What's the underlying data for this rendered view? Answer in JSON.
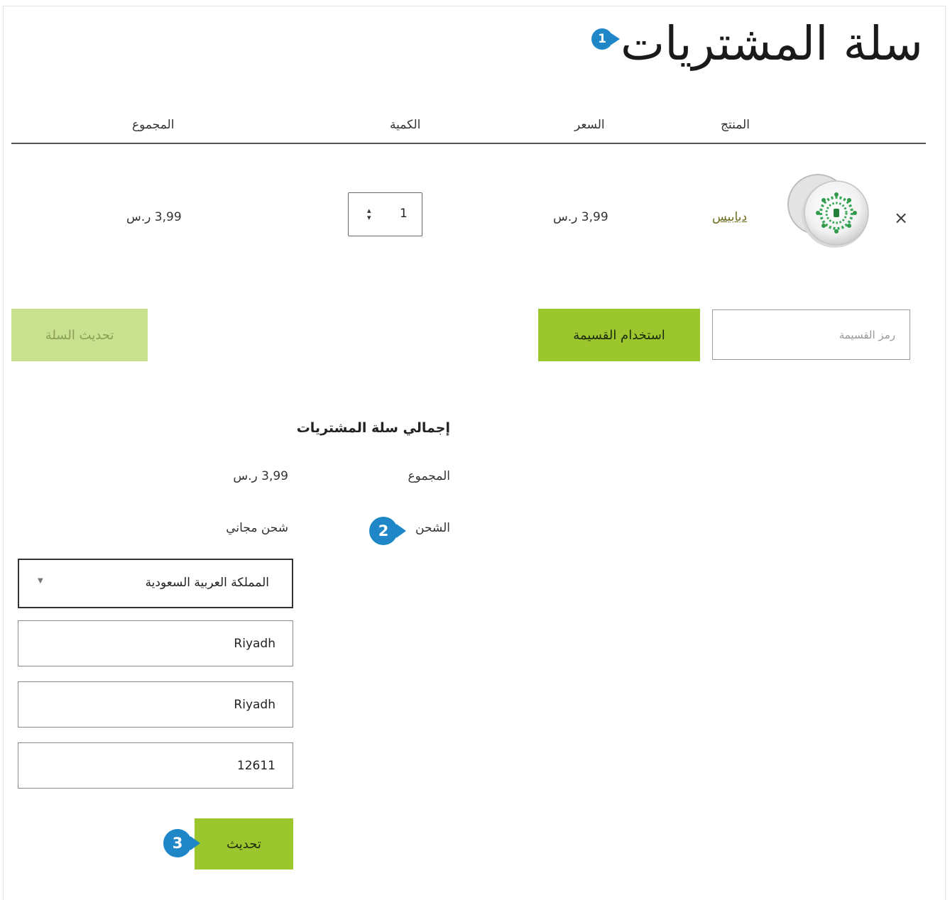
{
  "page": {
    "title": "سلة المشتريات"
  },
  "callouts": [
    "1",
    "2",
    "3"
  ],
  "table": {
    "headers": {
      "product": "المنتج",
      "price": "السعر",
      "quantity": "الكمية",
      "total": "المجموع"
    },
    "rows": [
      {
        "remove": "×",
        "product": "دبابيس",
        "price": "3,99 ر.س",
        "quantity": "1",
        "total": "3,99 ر.س",
        "thumbnail_icon": "saudi-vision-pin-badge"
      }
    ]
  },
  "coupon": {
    "placeholder": "رمز القسيمة",
    "apply_label": "استخدام القسيمة"
  },
  "update_cart_label": "تحديث السلة",
  "totals": {
    "title": "إجمالي سلة المشتريات",
    "subtotal_label": "المجموع",
    "subtotal_value": "3,99 ر.س",
    "shipping_label": "الشحن",
    "shipping_value": "شحن مجاني",
    "country": "المملكة العربية السعودية",
    "state": "Riyadh",
    "city": "Riyadh",
    "postcode": "12611",
    "update_label": "تحديث"
  },
  "colors": {
    "accent": "#9cc62d",
    "accent_disabled": "#c9e08e",
    "callout": "#1f87c8",
    "link": "#6c6c1a"
  }
}
